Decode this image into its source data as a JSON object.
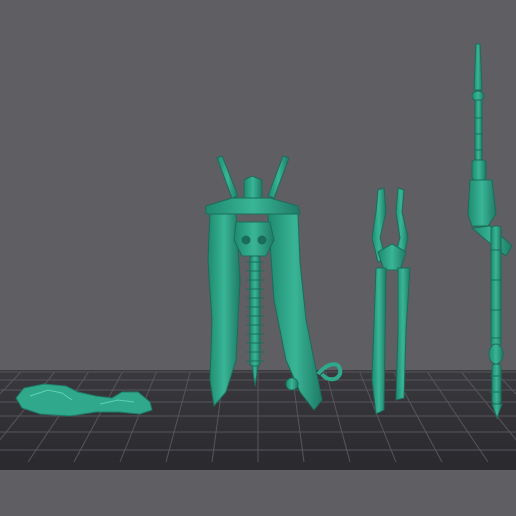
{
  "viewport": {
    "background": "#5f5e63",
    "plate_color": "#2f2e33",
    "grid_color": "#55545a",
    "model_color": "#2fa88c",
    "model_shade": "#1f7a66",
    "model_highlight": "#5fd2b4"
  },
  "models": [
    {
      "name": "rock-base-piece"
    },
    {
      "name": "cloaked-torso-piece"
    },
    {
      "name": "open-frame-piece"
    },
    {
      "name": "staff-weapon-piece"
    }
  ]
}
